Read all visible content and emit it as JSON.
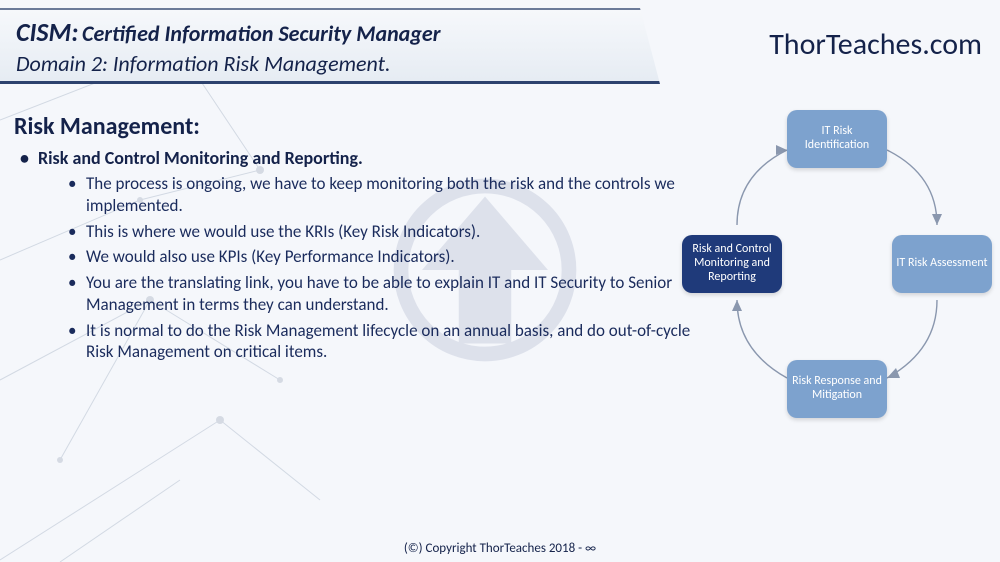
{
  "header": {
    "title_prefix": "CISM:",
    "title_rest": "Certified Information Security Manager",
    "subtitle": "Domain 2: Information Risk Management."
  },
  "brand": "ThorTeaches.com",
  "section_title": "Risk Management:",
  "topic": "Risk and Control Monitoring and Reporting.",
  "bullets": [
    "The process is ongoing, we have to keep monitoring both the risk and the controls we implemented.",
    "This is where we would use the KRIs (Key Risk Indicators).",
    "We would also use KPIs (Key Performance Indicators).",
    "You are the translating link, you have to be able to explain IT and IT Security to Senior Management in terms they can understand.",
    "It is normal to do the Risk Management lifecycle on an annual basis, and do out-of-cycle Risk Management on critical items."
  ],
  "cycle": {
    "top": "IT Risk Identification",
    "right": "IT Risk Assessment",
    "bottom": "Risk Response and Mitigation",
    "left": "Risk and Control Monitoring and Reporting"
  },
  "footer": "(©) Copyright ThorTeaches 2018 - ∞"
}
